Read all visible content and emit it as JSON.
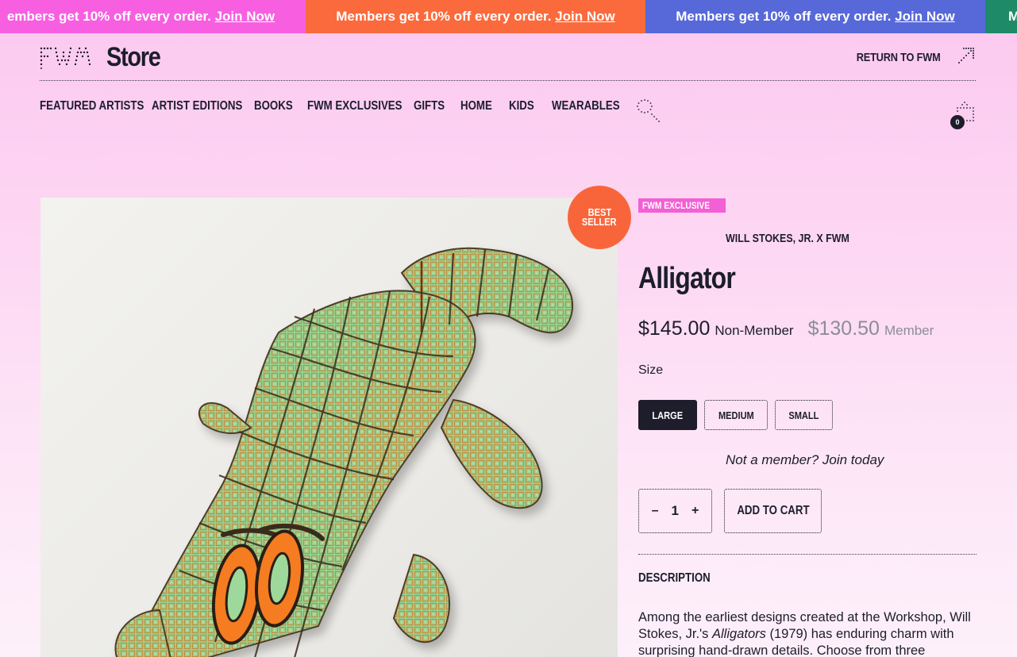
{
  "promo": {
    "text": "Members get 10% off every order.",
    "link": "Join Now",
    "partial_start": "embers get 10% off every order.",
    "partial_end": "M",
    "colors": [
      "#f75fe0",
      "#fb6a3c",
      "#5768d8",
      "#1f8a68"
    ]
  },
  "header": {
    "logo_word": "Store",
    "return_label": "RETURN TO FWM",
    "cart_count": "0"
  },
  "nav": {
    "items": [
      "FEATURED ARTISTS",
      "ARTIST EDITIONS",
      "BOOKS",
      "FWM EXCLUSIVES",
      "GIFTS",
      "HOME",
      "KIDS",
      "WEARABLES"
    ]
  },
  "product": {
    "badge_line1": "BEST",
    "badge_line2": "SELLER",
    "tag": "FWM EXCLUSIVE",
    "artist": "WILL STOKES, JR. X FWM",
    "title": "Alligator",
    "price": "$145.00",
    "price_label": "Non-Member",
    "member_price": "$130.50",
    "member_label": "Member",
    "size_label": "Size",
    "sizes": [
      "LARGE",
      "MEDIUM",
      "SMALL"
    ],
    "selected_size": "LARGE",
    "join_text": "Not a member? Join today",
    "quantity": "1",
    "qty_minus": "–",
    "qty_plus": "+",
    "add_to_cart": "ADD TO CART",
    "description_heading": "DESCRIPTION",
    "description_pre": "Among the earliest designs created at the Workshop, Will Stokes, Jr.'s ",
    "description_em": "Alligators",
    "description_post": " (1979) has enduring charm with surprising hand-drawn details. Choose from three"
  },
  "icons": {
    "logo": "fwm-dotted-logo-icon",
    "return": "arrow-up-right-icon",
    "search": "search-icon",
    "cart": "shopping-bag-icon"
  },
  "colors": {
    "ink": "#1d1d2b",
    "badge": "#f9653b",
    "tag": "#f35fd5",
    "muted": "#8d8d96"
  }
}
